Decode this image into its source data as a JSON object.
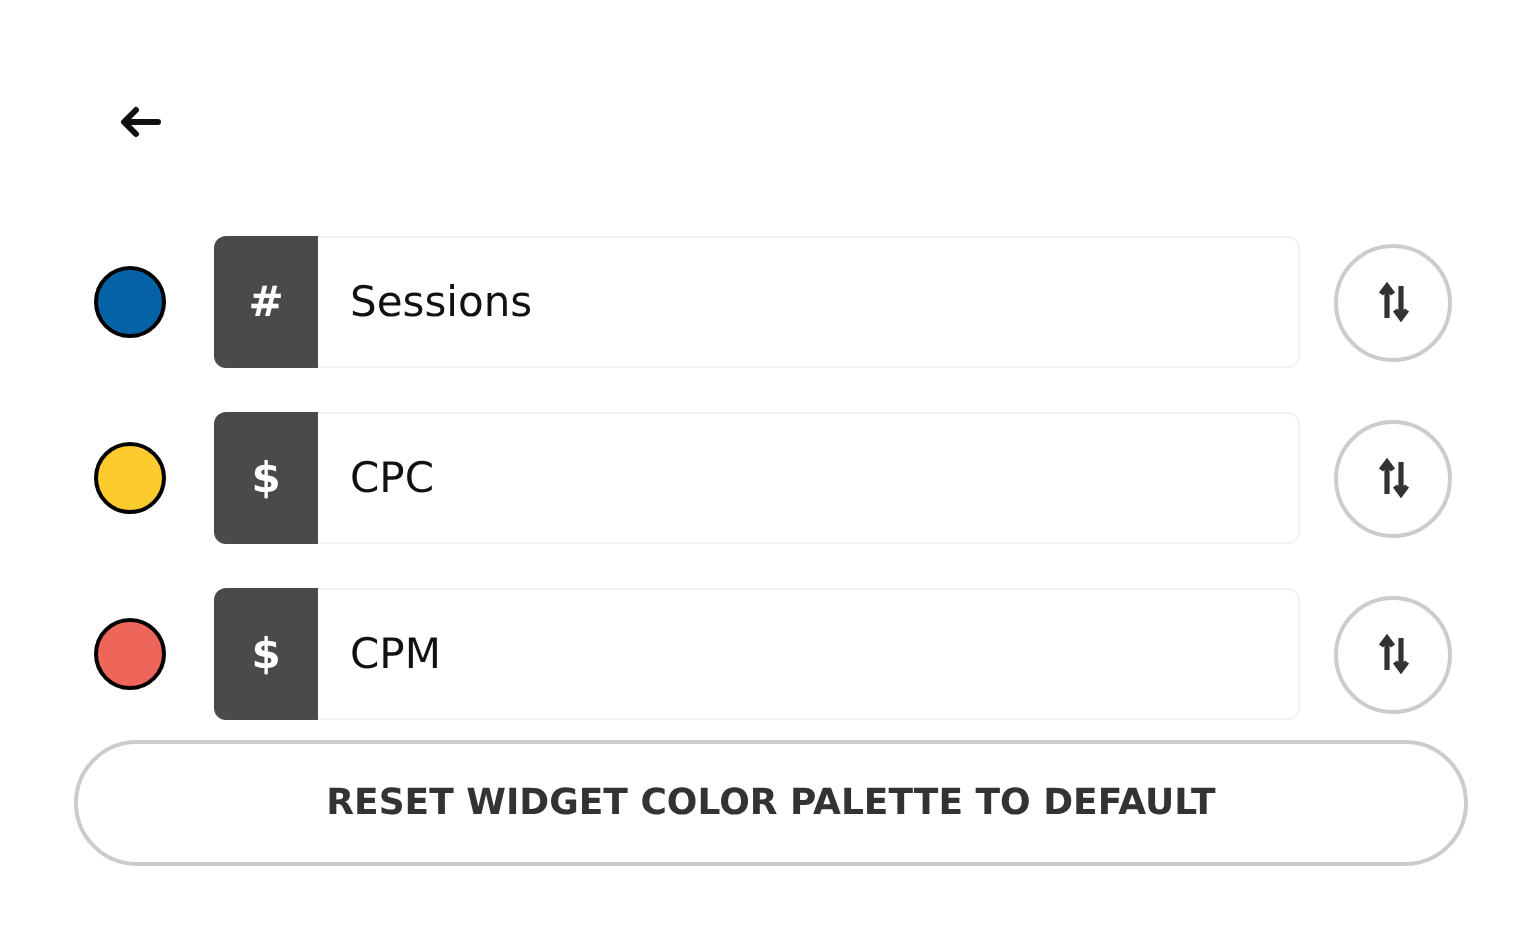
{
  "metrics": [
    {
      "color": "#0563a5",
      "prefix": "#",
      "name": "Sessions"
    },
    {
      "color": "#fecb2f",
      "prefix": "$",
      "name": "CPC"
    },
    {
      "color": "#ee665a",
      "prefix": "$",
      "name": "CPM"
    }
  ],
  "reset_button": "RESET WIDGET COLOR PALETTE TO DEFAULT"
}
